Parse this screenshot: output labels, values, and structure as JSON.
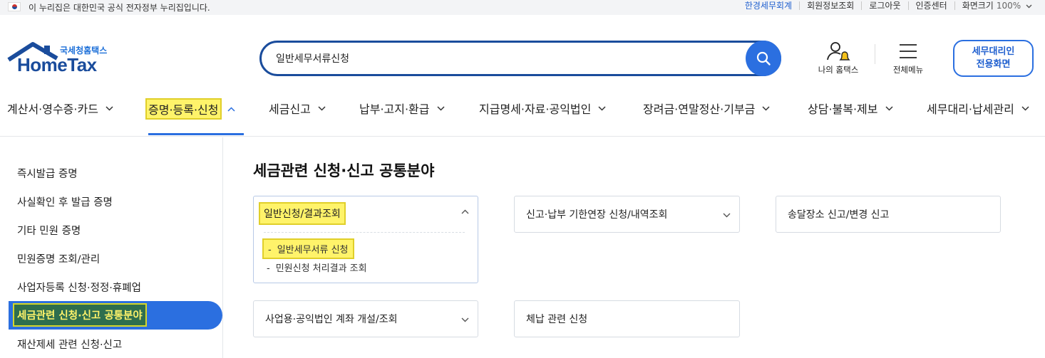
{
  "topbar": {
    "notice": "이 누리집은 대한민국 공식 전자정부 누리집입니다.",
    "links": [
      "한경세무회계",
      "회원정보조회",
      "로그아웃",
      "인증센터"
    ],
    "zoom_label": "화면크기",
    "zoom_value": "100%"
  },
  "logo": {
    "subtitle": "국세청홈택스",
    "name": "HomeTax"
  },
  "search": {
    "value": "일반세무서류신청"
  },
  "header": {
    "my_hometax": "나의 홈택스",
    "all_menu": "전체메뉴",
    "agent_line1": "세무대리인",
    "agent_line2": "전용화면"
  },
  "nav": {
    "items": [
      "계산서·영수증·카드",
      "증명·등록·신청",
      "세금신고",
      "납부·고지·환급",
      "지급명세·자료·공익법인",
      "장려금·연말정산·기부금",
      "상담·불복·제보",
      "세무대리·납세관리"
    ]
  },
  "sidebar": {
    "items": [
      "즉시발급 증명",
      "사실확인 후 발급 증명",
      "기타 민원 증명",
      "민원증명 조회/관리",
      "사업자등록 신청·정정·휴폐업",
      "세금관련 신청·신고 공통분야",
      "재산제세 관련 신청·신고"
    ]
  },
  "content": {
    "title": "세금관련 신청·신고 공통분야",
    "cards": [
      {
        "title": "일반신청/결과조회",
        "subs": [
          "일반세무서류 신청",
          "민원신청 처리결과 조회"
        ]
      },
      {
        "title": "신고·납부 기한연장 신청/내역조회"
      },
      {
        "title": "송달장소 신고/변경 신고"
      },
      {
        "title": "사업용·공익법인 계좌 개설/조회"
      },
      {
        "title": "체납 관련 신청"
      }
    ]
  },
  "colors": {
    "primary": "#2b6fe0",
    "navy": "#1a4c9c",
    "highlight": "#fff36a"
  }
}
